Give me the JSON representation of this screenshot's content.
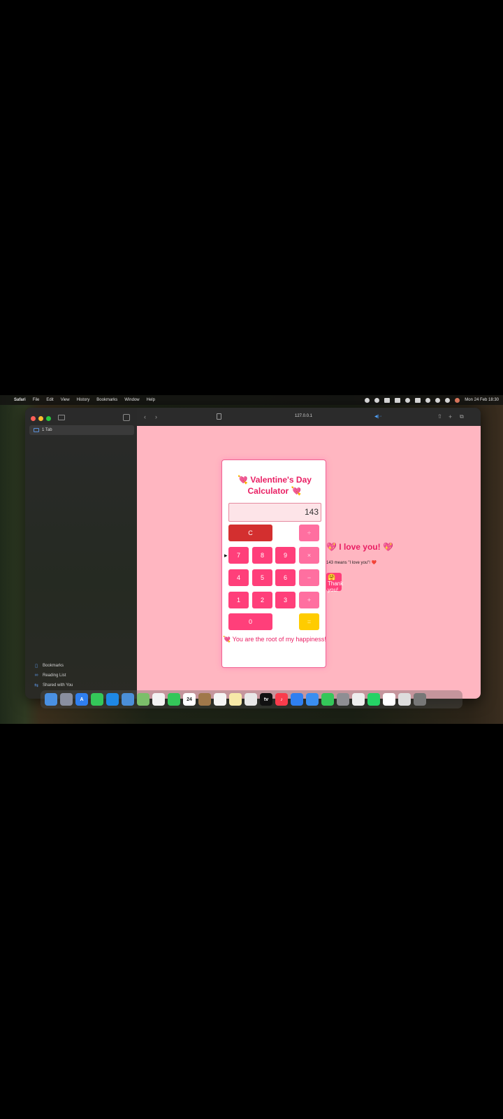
{
  "menubar": {
    "app": "Safari",
    "items": [
      "File",
      "Edit",
      "View",
      "History",
      "Bookmarks",
      "Window",
      "Help"
    ],
    "clock": "Mon 24 Feb 18:30"
  },
  "sidebar": {
    "tab_label": "1 Tab",
    "bookmarks": "Bookmarks",
    "reading_list": "Reading List",
    "shared": "Shared with You"
  },
  "toolbar": {
    "address": "127.0.0.1"
  },
  "calculator": {
    "title": "💘 Valentine's Day Calculator 💘",
    "display": "143",
    "keys": {
      "clear": "C",
      "divide": "÷",
      "k7": "7",
      "k8": "8",
      "k9": "9",
      "multiply": "×",
      "k4": "4",
      "k5": "5",
      "k6": "6",
      "minus": "−",
      "k1": "1",
      "k2": "2",
      "k3": "3",
      "plus": "+",
      "k0": "0",
      "equals": "="
    },
    "footer": "💘 You are the root of my happiness!"
  },
  "message": {
    "love": "💖 I love you! 💖",
    "meaning": "143 means \"I love you\"! ❤️",
    "thanks_emoji": "🤗",
    "thanks": "Thank you!"
  },
  "dock": {
    "calendar_day": "24",
    "tv": "tv"
  },
  "colors": {
    "page_bg": "#ffb6c1",
    "accent": "#e91e63",
    "key": "#ff3f7a",
    "clear": "#d32f2f",
    "equals": "#ffcc00"
  }
}
